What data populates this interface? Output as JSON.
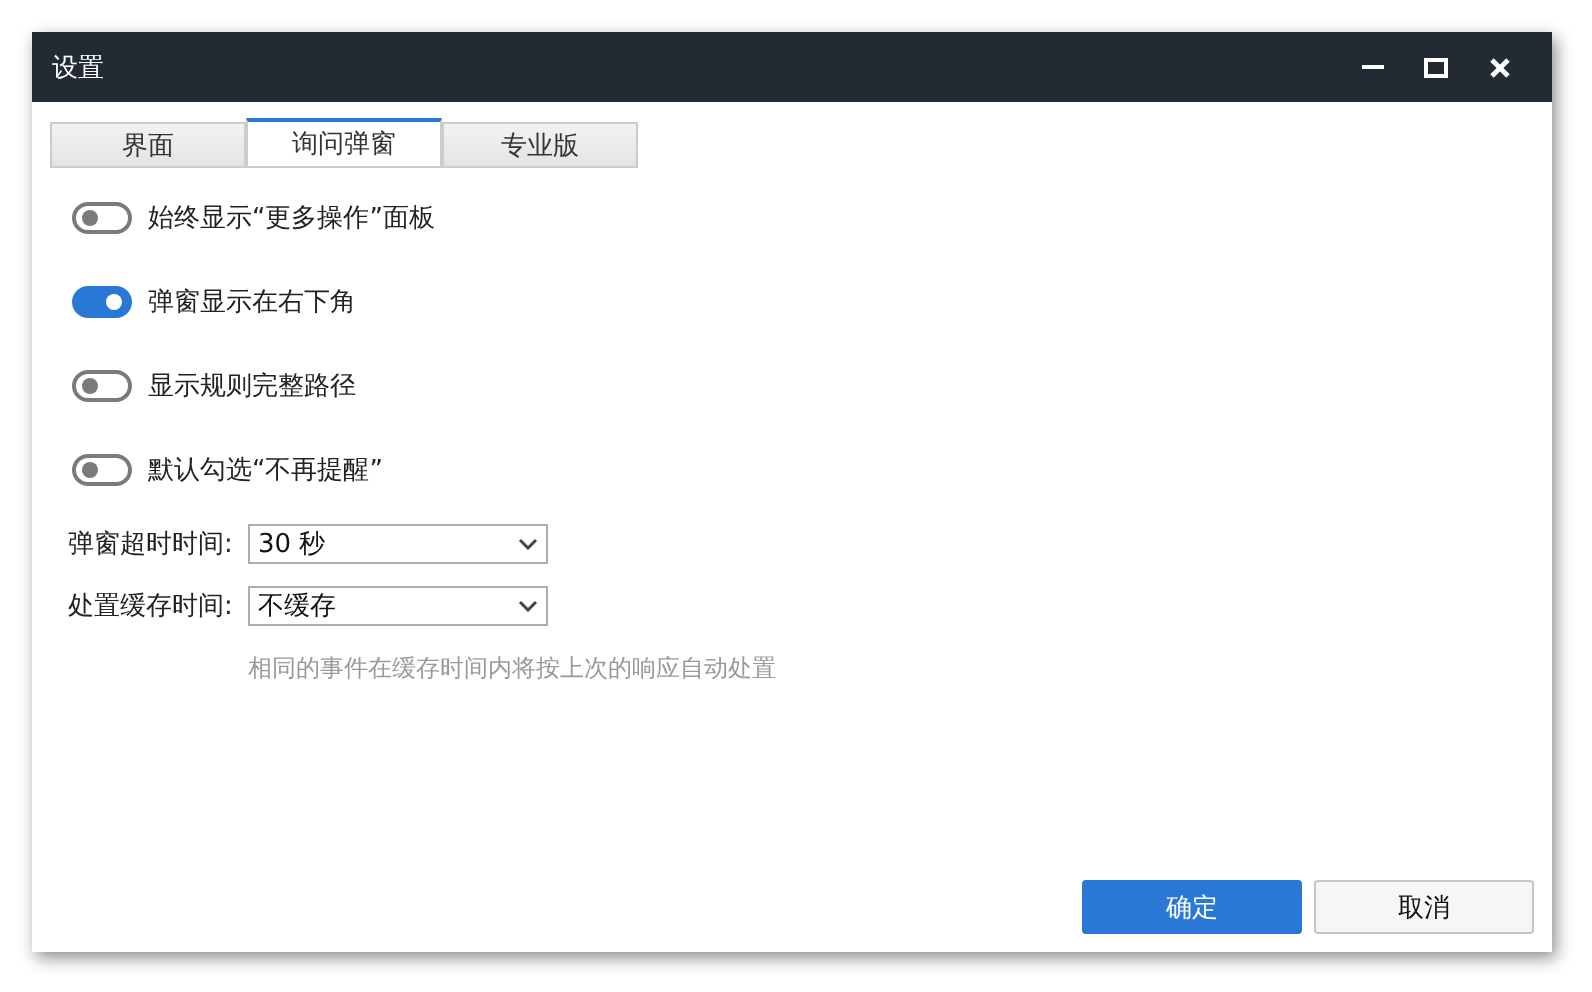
{
  "window": {
    "title": "设置"
  },
  "tabs": [
    {
      "label": "界面",
      "selected": false
    },
    {
      "label": "询问弹窗",
      "selected": true
    },
    {
      "label": "专业版",
      "selected": false
    }
  ],
  "toggles": [
    {
      "label": "始终显示“更多操作”面板",
      "on": false
    },
    {
      "label": "弹窗显示在右下角",
      "on": true
    },
    {
      "label": "显示规则完整路径",
      "on": false
    },
    {
      "label": "默认勾选“不再提醒”",
      "on": false
    }
  ],
  "fields": [
    {
      "label": "弹窗超时时间:",
      "value": "30 秒"
    },
    {
      "label": "处置缓存时间:",
      "value": "不缓存"
    }
  ],
  "hint": "相同的事件在缓存时间内将按上次的响应自动处置",
  "buttons": [
    {
      "label": "确定",
      "kind": "primary"
    },
    {
      "label": "取消",
      "kind": "secondary"
    }
  ]
}
